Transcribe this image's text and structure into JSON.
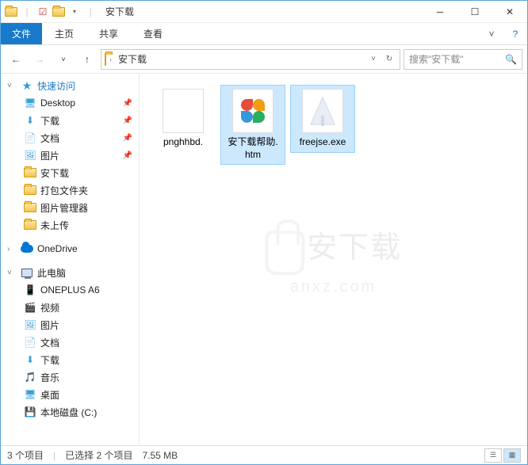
{
  "window": {
    "title": "安下载"
  },
  "ribbon": {
    "file": "文件",
    "tabs": [
      "主页",
      "共享",
      "查看"
    ]
  },
  "nav": {
    "breadcrumb": "安下载",
    "search_placeholder": "搜索\"安下载\""
  },
  "sidebar": {
    "quick_access": "快速访问",
    "items": [
      {
        "label": "Desktop",
        "pinned": true,
        "icon": "desktop"
      },
      {
        "label": "下载",
        "pinned": true,
        "icon": "download"
      },
      {
        "label": "文档",
        "pinned": true,
        "icon": "document"
      },
      {
        "label": "图片",
        "pinned": true,
        "icon": "picture"
      },
      {
        "label": "安下载",
        "pinned": false,
        "icon": "folder"
      },
      {
        "label": "打包文件夹",
        "pinned": false,
        "icon": "folder"
      },
      {
        "label": "图片管理器",
        "pinned": false,
        "icon": "folder"
      },
      {
        "label": "未上传",
        "pinned": false,
        "icon": "folder"
      }
    ],
    "onedrive": "OneDrive",
    "this_pc": "此电脑",
    "pc_items": [
      {
        "label": "ONEPLUS A6",
        "icon": "device"
      },
      {
        "label": "视频",
        "icon": "video"
      },
      {
        "label": "图片",
        "icon": "picture"
      },
      {
        "label": "文档",
        "icon": "document"
      },
      {
        "label": "下载",
        "icon": "download"
      },
      {
        "label": "音乐",
        "icon": "music"
      },
      {
        "label": "桌面",
        "icon": "desktop"
      },
      {
        "label": "本地磁盘 (C:)",
        "icon": "disk"
      }
    ]
  },
  "files": [
    {
      "name": "pnghhbd.",
      "type": "generic",
      "selected": false
    },
    {
      "name": "安下载帮助.htm",
      "type": "htm",
      "selected": true
    },
    {
      "name": "freejse.exe",
      "type": "exe",
      "selected": true
    }
  ],
  "statusbar": {
    "count": "3 个项目",
    "selection": "已选择 2 个项目",
    "size": "7.55 MB"
  },
  "watermark": {
    "line1": "安下载",
    "line2": "anxz.com"
  }
}
